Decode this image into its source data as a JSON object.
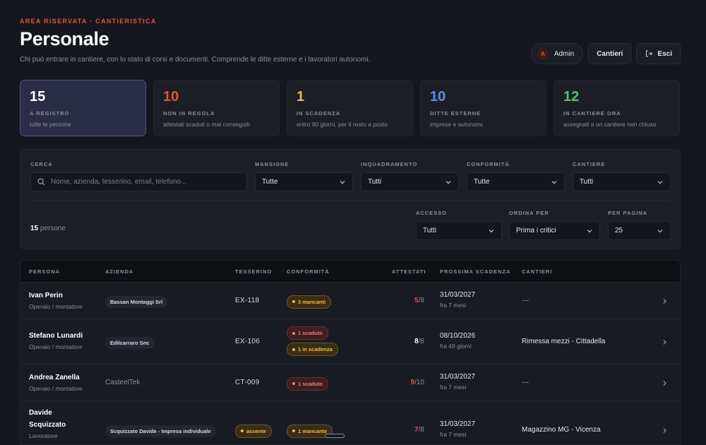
{
  "header": {
    "eyebrow": "AREA RISERVATA · CANTIERISTICA",
    "title": "Personale",
    "subtitle": "Chi può entrare in cantiere, con lo stato di corsi e documenti. Comprende le ditte esterne e i lavoratori autonomi.",
    "user_initial": "A",
    "user_label": "Admin",
    "cantieri_label": "Cantieri",
    "esci_label": "Esci"
  },
  "stats": [
    {
      "num": "15",
      "label": "A REGISTRO",
      "sub": "tutte le persone",
      "color": "#ffffff",
      "active": true
    },
    {
      "num": "10",
      "label": "NON IN REGOLA",
      "sub": "attestati scaduti o mai conseguiti",
      "color": "#e0533f",
      "active": false
    },
    {
      "num": "1",
      "label": "IN SCADENZA",
      "sub": "entro 90 giorni, per il resto a posto",
      "color": "#e9b94a",
      "active": false
    },
    {
      "num": "10",
      "label": "DITTE ESTERNE",
      "sub": "imprese e autonomi",
      "color": "#5b8def",
      "active": false
    },
    {
      "num": "12",
      "label": "IN CANTIERE ORA",
      "sub": "assegnati a un cantiere non chiuso",
      "color": "#4fc36b",
      "active": false
    }
  ],
  "filters": {
    "search_label": "CERCA",
    "search_placeholder": "Nome, azienda, tesserino, email, telefono...",
    "search_value": "",
    "mansione_label": "MANSIONE",
    "mansione_value": "Tutte",
    "inquadramento_label": "INQUADRAMENTO",
    "inquadramento_value": "Tutti",
    "conformita_label": "CONFORMITÀ",
    "conformita_value": "Tutte",
    "cantiere_label": "CANTIERE",
    "cantiere_value": "Tutti",
    "accesso_label": "ACCESSO",
    "accesso_value": "Tutti",
    "ordina_label": "ORDINA PER",
    "ordina_value": "Prima i critici",
    "perpagina_label": "PER PAGINA",
    "perpagina_value": "25",
    "count_num": "15",
    "count_label": "persone"
  },
  "table": {
    "headers": [
      "PERSONA",
      "AZIENDA",
      "TESSERINO",
      "CONFORMITÀ",
      "ATTESTATI",
      "PROSSIMA SCADENZA",
      "CANTIERI"
    ],
    "rows": [
      {
        "name": "Ivan Perin",
        "role": "Operaio / montatore",
        "company": "Bassan Montaggi Srl",
        "tess": "EX-118",
        "att_num": "5",
        "att_den": "/8",
        "date": "31/03/2027",
        "date_sub": "fra 7 mesi",
        "site": "—"
      },
      {
        "name": "Stefano Lunardi",
        "role": "Operaio / montatore",
        "company": "Edilcarraro Snc",
        "tess": "EX-106",
        "att_num": "8",
        "att_den": "/8",
        "date": "08/10/2026",
        "date_sub": "fra 49 giorni",
        "site": "Rimessa mezzi - Cittadella"
      },
      {
        "name": "Andrea Zanella",
        "role": "Operaio / montatore",
        "company": "CasteelTek",
        "tess": "CT-009",
        "att_num": "9",
        "att_den": "/10",
        "date": "31/03/2027",
        "date_sub": "fra 7 mesi",
        "site": "—"
      },
      {
        "name": "Davide",
        "name2": "Scquizzato",
        "role": "Lavoratore",
        "company": "Scquizzato Davide - Impresa individuale",
        "company_badge": "assente",
        "tess": "",
        "att_num": "7",
        "att_den": "/8",
        "date": "31/03/2027",
        "date_sub": "fra 7 mesi",
        "site": "Magazzino MG - Vicenza"
      }
    ],
    "badges": {
      "r0": [
        "3 mancanti"
      ],
      "r1": [
        "1 scaduto",
        "1 in scadenza"
      ],
      "r2": [
        "1 scaduto"
      ],
      "r3": [
        "1 mancante"
      ]
    }
  },
  "colors": {
    "accent": "#e0533f",
    "warn": "#f0b93a",
    "error": "#f07a7a",
    "att_red": "#e0533f",
    "att_white": "#ffffff"
  }
}
